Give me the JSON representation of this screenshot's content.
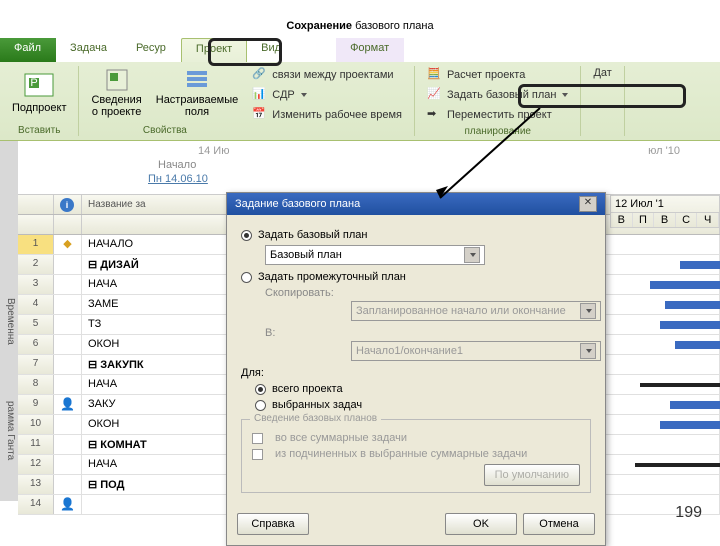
{
  "title_strong": "Сохранение",
  "title_rest": " базового плана",
  "tabs": {
    "file": "Файл",
    "task": "Задача",
    "resource": "Ресур",
    "project": "Проект",
    "view": "Вид",
    "format": "Формат"
  },
  "ribbon": {
    "insert": {
      "subproject": "Подпроект",
      "group": "Вставить"
    },
    "props": {
      "info": "Сведения\nо проекте",
      "fields": "Настраиваемые\nполя",
      "links": "связи между проектами",
      "wbs": "СДР",
      "worktime": "Изменить рабочее время",
      "group": "Свойства"
    },
    "plan": {
      "calc": "Расчет проекта",
      "baseline": "Задать базовый план",
      "move": "Переместить проект",
      "group": "планирование"
    },
    "date": {
      "label": "Дат"
    }
  },
  "timeline": {
    "vlabel": "Временна",
    "month": "14 Ию",
    "start": "Начало",
    "date": "Пн 14.06.10",
    "right": "юл '10"
  },
  "grid": {
    "header": {
      "name": "Название за"
    },
    "rows": [
      {
        "n": "1",
        "name": "НАЧАЛО",
        "ind": "note",
        "sel": true
      },
      {
        "n": "2",
        "name": "ДИЗАЙ",
        "bold": true,
        "collapse": true
      },
      {
        "n": "3",
        "name": "НАЧА"
      },
      {
        "n": "4",
        "name": "ЗАМЕ"
      },
      {
        "n": "5",
        "name": "ТЗ"
      },
      {
        "n": "6",
        "name": "ОКОН"
      },
      {
        "n": "7",
        "name": "ЗАКУПК",
        "bold": true,
        "collapse": true
      },
      {
        "n": "8",
        "name": "НАЧА"
      },
      {
        "n": "9",
        "name": "ЗАКУ",
        "ind": "person"
      },
      {
        "n": "10",
        "name": "ОКОН"
      },
      {
        "n": "11",
        "name": "КОМНАТ",
        "bold": true,
        "collapse": true
      },
      {
        "n": "12",
        "name": "НАЧА"
      },
      {
        "n": "13",
        "name": "ПОД",
        "bold": true,
        "collapse": true
      },
      {
        "n": "14",
        "name": "",
        "ind": "person"
      }
    ],
    "vlabel2": "рамма Ганта",
    "week": "12 Июл '1",
    "days": [
      "В",
      "П",
      "В",
      "С",
      "Ч"
    ]
  },
  "dialog": {
    "title": "Задание базового плана",
    "opt_baseline": "Задать базовый план",
    "combo_baseline": "Базовый план",
    "opt_interim": "Задать промежуточный план",
    "copy_lbl": "Скопировать:",
    "copy_val": "Запланированное начало или окончание",
    "to_lbl": "В:",
    "to_val": "Начало1/окончание1",
    "for_lbl": "Для:",
    "for_all": "всего проекта",
    "for_sel": "выбранных задач",
    "fs_legend": "Сведение базовых планов",
    "chk1": "во все суммарные задачи",
    "chk2": "из подчиненных в выбранные суммарные задачи",
    "defaults": "По умолчанию",
    "help": "Справка",
    "ok": "OK",
    "cancel": "Отмена"
  },
  "slide": "199"
}
